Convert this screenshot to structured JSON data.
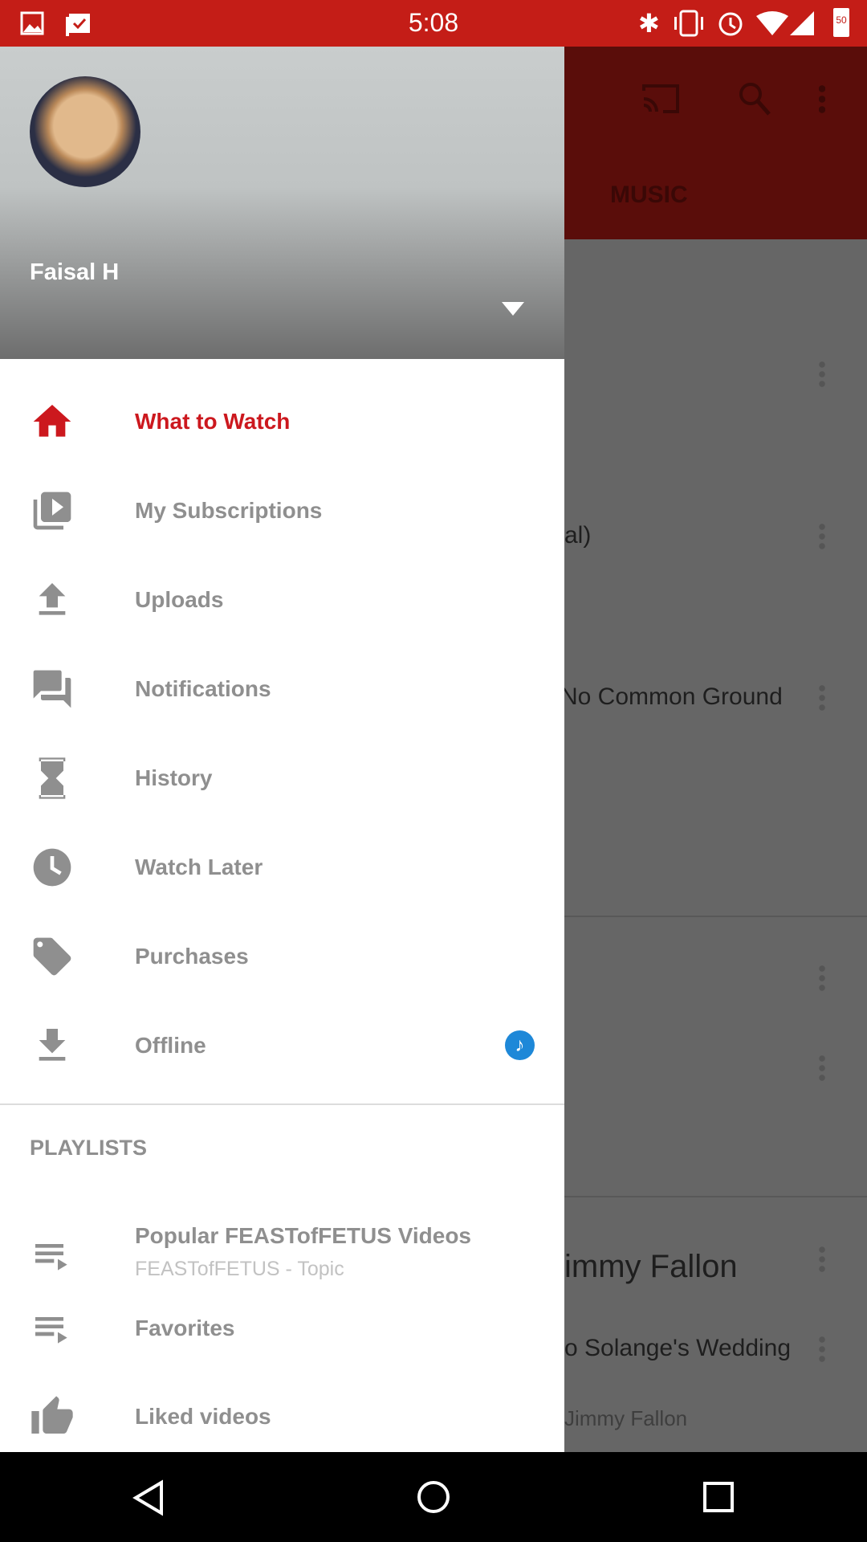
{
  "status_bar": {
    "time": "5:08",
    "battery": "50",
    "icons": [
      "image-icon",
      "clipboard-check-icon",
      "bluetooth-icon",
      "vibrate-icon",
      "alarm-icon",
      "wifi-icon",
      "signal-icon",
      "battery-icon"
    ]
  },
  "background": {
    "tab": "MUSIC",
    "texts": [
      "al)",
      "No Common Ground",
      "immy Fallon",
      "o Solange's Wedding",
      "Jimmy Fallon"
    ]
  },
  "account": {
    "name": "Faisal H"
  },
  "menu": [
    {
      "label": "What to Watch",
      "icon": "home-icon",
      "active": true
    },
    {
      "label": "My Subscriptions",
      "icon": "subscriptions-icon"
    },
    {
      "label": "Uploads",
      "icon": "upload-icon"
    },
    {
      "label": "Notifications",
      "icon": "notifications-icon"
    },
    {
      "label": "History",
      "icon": "hourglass-icon"
    },
    {
      "label": "Watch Later",
      "icon": "clock-icon"
    },
    {
      "label": "Purchases",
      "icon": "tag-icon"
    },
    {
      "label": "Offline",
      "icon": "download-icon",
      "badge": "music-note-icon"
    }
  ],
  "playlists": {
    "heading": "PLAYLISTS",
    "items": [
      {
        "label": "Popular FEASTofFETUS Videos",
        "subtitle": "FEASTofFETUS - Topic",
        "icon": "playlist-icon"
      },
      {
        "label": "Favorites",
        "icon": "playlist-icon"
      },
      {
        "label": "Liked videos",
        "icon": "thumbs-up-icon"
      }
    ]
  },
  "colors": {
    "accent": "#cc181e",
    "status_bar": "#c41d17",
    "badge": "#1e88d8"
  }
}
